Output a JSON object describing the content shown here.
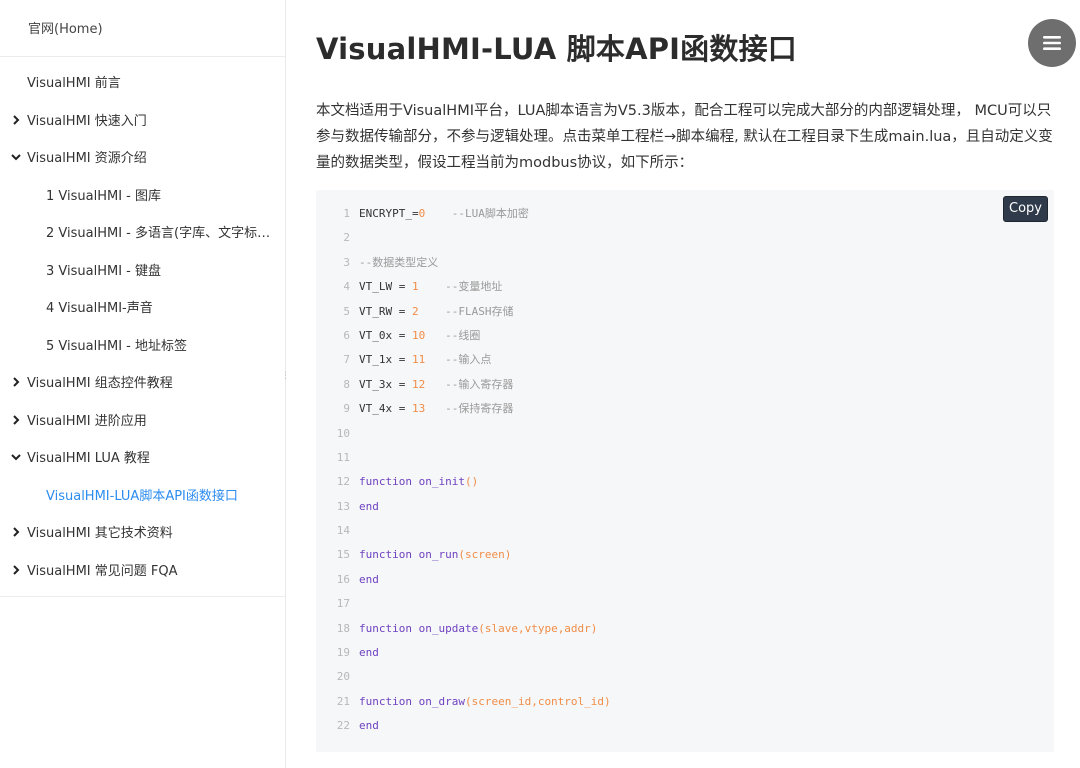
{
  "sidebar": {
    "home": "官网(Home)",
    "items": [
      {
        "label": "VisualHMI 前言",
        "arrow": ""
      },
      {
        "label": "VisualHMI 快速入门",
        "arrow": "right"
      },
      {
        "label": "VisualHMI 资源介绍",
        "arrow": "down"
      },
      {
        "label": "1 VisualHMI - 图库",
        "arrow": ""
      },
      {
        "label": "2 VisualHMI - 多语言(字库、文字标…",
        "arrow": ""
      },
      {
        "label": "3 VisualHMI - 键盘",
        "arrow": ""
      },
      {
        "label": "4 VisualHMI-声音",
        "arrow": ""
      },
      {
        "label": "5 VisualHMI - 地址标签",
        "arrow": ""
      },
      {
        "label": "VisualHMI 组态控件教程",
        "arrow": "right"
      },
      {
        "label": "VisualHMI 进阶应用",
        "arrow": "right"
      },
      {
        "label": "VisualHMI LUA 教程",
        "arrow": "down"
      },
      {
        "label": "VisualHMI-LUA脚本API函数接口",
        "arrow": ""
      },
      {
        "label": "VisualHMI 其它技术资料",
        "arrow": "right"
      },
      {
        "label": "VisualHMI 常见问题 FQA",
        "arrow": "right"
      }
    ]
  },
  "main": {
    "title": "VisualHMI-LUA 脚本API函数接口",
    "intro": "本文档适用于VisualHMI平台，LUA脚本语言为V5.3版本，配合工程可以完成大部分的内部逻辑处理， MCU可以只参与数据传输部分，不参与逻辑处理。点击菜单工程栏→脚本编程, 默认在工程目录下生成main.lua，且自动定义变量的数据类型，假设工程当前为modbus协议，如下所示：",
    "copy_label": "Copy",
    "menu_icon": "hamburger-menu-icon"
  },
  "code": {
    "lines": [
      {
        "n": "1",
        "a": "ENCRYPT_=",
        "b": "0",
        "c": "    --LUA脚本加密",
        "t": "assign"
      },
      {
        "n": "2",
        "t": "blank"
      },
      {
        "n": "3",
        "c": "--数据类型定义",
        "t": "comment"
      },
      {
        "n": "4",
        "a": "VT_LW = ",
        "b": "1",
        "c": "    --变量地址",
        "t": "assign"
      },
      {
        "n": "5",
        "a": "VT_RW = ",
        "b": "2",
        "c": "    --FLASH存储",
        "t": "assign"
      },
      {
        "n": "6",
        "a": "VT_0x = ",
        "b": "10",
        "c": "   --线圈",
        "t": "assign"
      },
      {
        "n": "7",
        "a": "VT_1x = ",
        "b": "11",
        "c": "   --输入点",
        "t": "assign"
      },
      {
        "n": "8",
        "a": "VT_3x = ",
        "b": "12",
        "c": "   --输入寄存器",
        "t": "assign"
      },
      {
        "n": "9",
        "a": "VT_4x = ",
        "b": "13",
        "c": "   --保持寄存器",
        "t": "assign"
      },
      {
        "n": "10",
        "t": "blank"
      },
      {
        "n": "11",
        "t": "blank"
      },
      {
        "n": "12",
        "a": "function on_init",
        "b": "()",
        "t": "func"
      },
      {
        "n": "13",
        "a": "end",
        "t": "kw"
      },
      {
        "n": "14",
        "t": "blank"
      },
      {
        "n": "15",
        "a": "function on_run",
        "b": "(screen)",
        "t": "func"
      },
      {
        "n": "16",
        "a": "end",
        "t": "kw"
      },
      {
        "n": "17",
        "t": "blank"
      },
      {
        "n": "18",
        "a": "function on_update",
        "b": "(slave,vtype,addr)",
        "t": "func"
      },
      {
        "n": "19",
        "a": "end",
        "t": "kw"
      },
      {
        "n": "20",
        "t": "blank"
      },
      {
        "n": "21",
        "a": "function on_draw",
        "b": "(screen_id,control_id)",
        "t": "func"
      },
      {
        "n": "22",
        "a": "end",
        "t": "kw"
      }
    ]
  }
}
